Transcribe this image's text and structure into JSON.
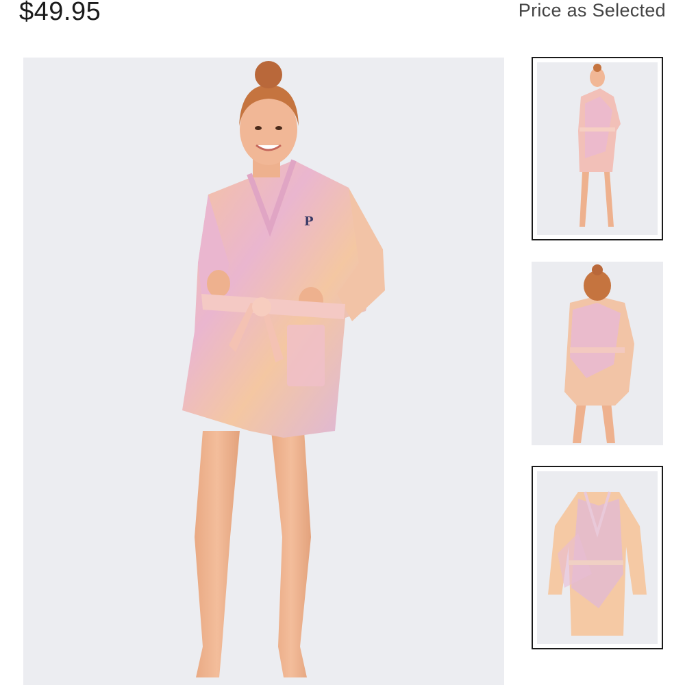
{
  "product": {
    "price": "$49.95",
    "price_note": "Price as Selected"
  },
  "gallery": {
    "main_image": "model-wearing-tie-dye-robe-front",
    "thumbnails": [
      {
        "image": "model-front-full",
        "selected": true
      },
      {
        "image": "model-back-view",
        "selected": false
      },
      {
        "image": "robe-flat-lay",
        "selected": true
      }
    ]
  },
  "colors": {
    "robe_pink": "#eab6cf",
    "robe_peach": "#f6c49c",
    "robe_lavender": "#d9b3e3",
    "background": "#ecedf1",
    "skin": "#eeb18e",
    "hair": "#c5743f"
  }
}
